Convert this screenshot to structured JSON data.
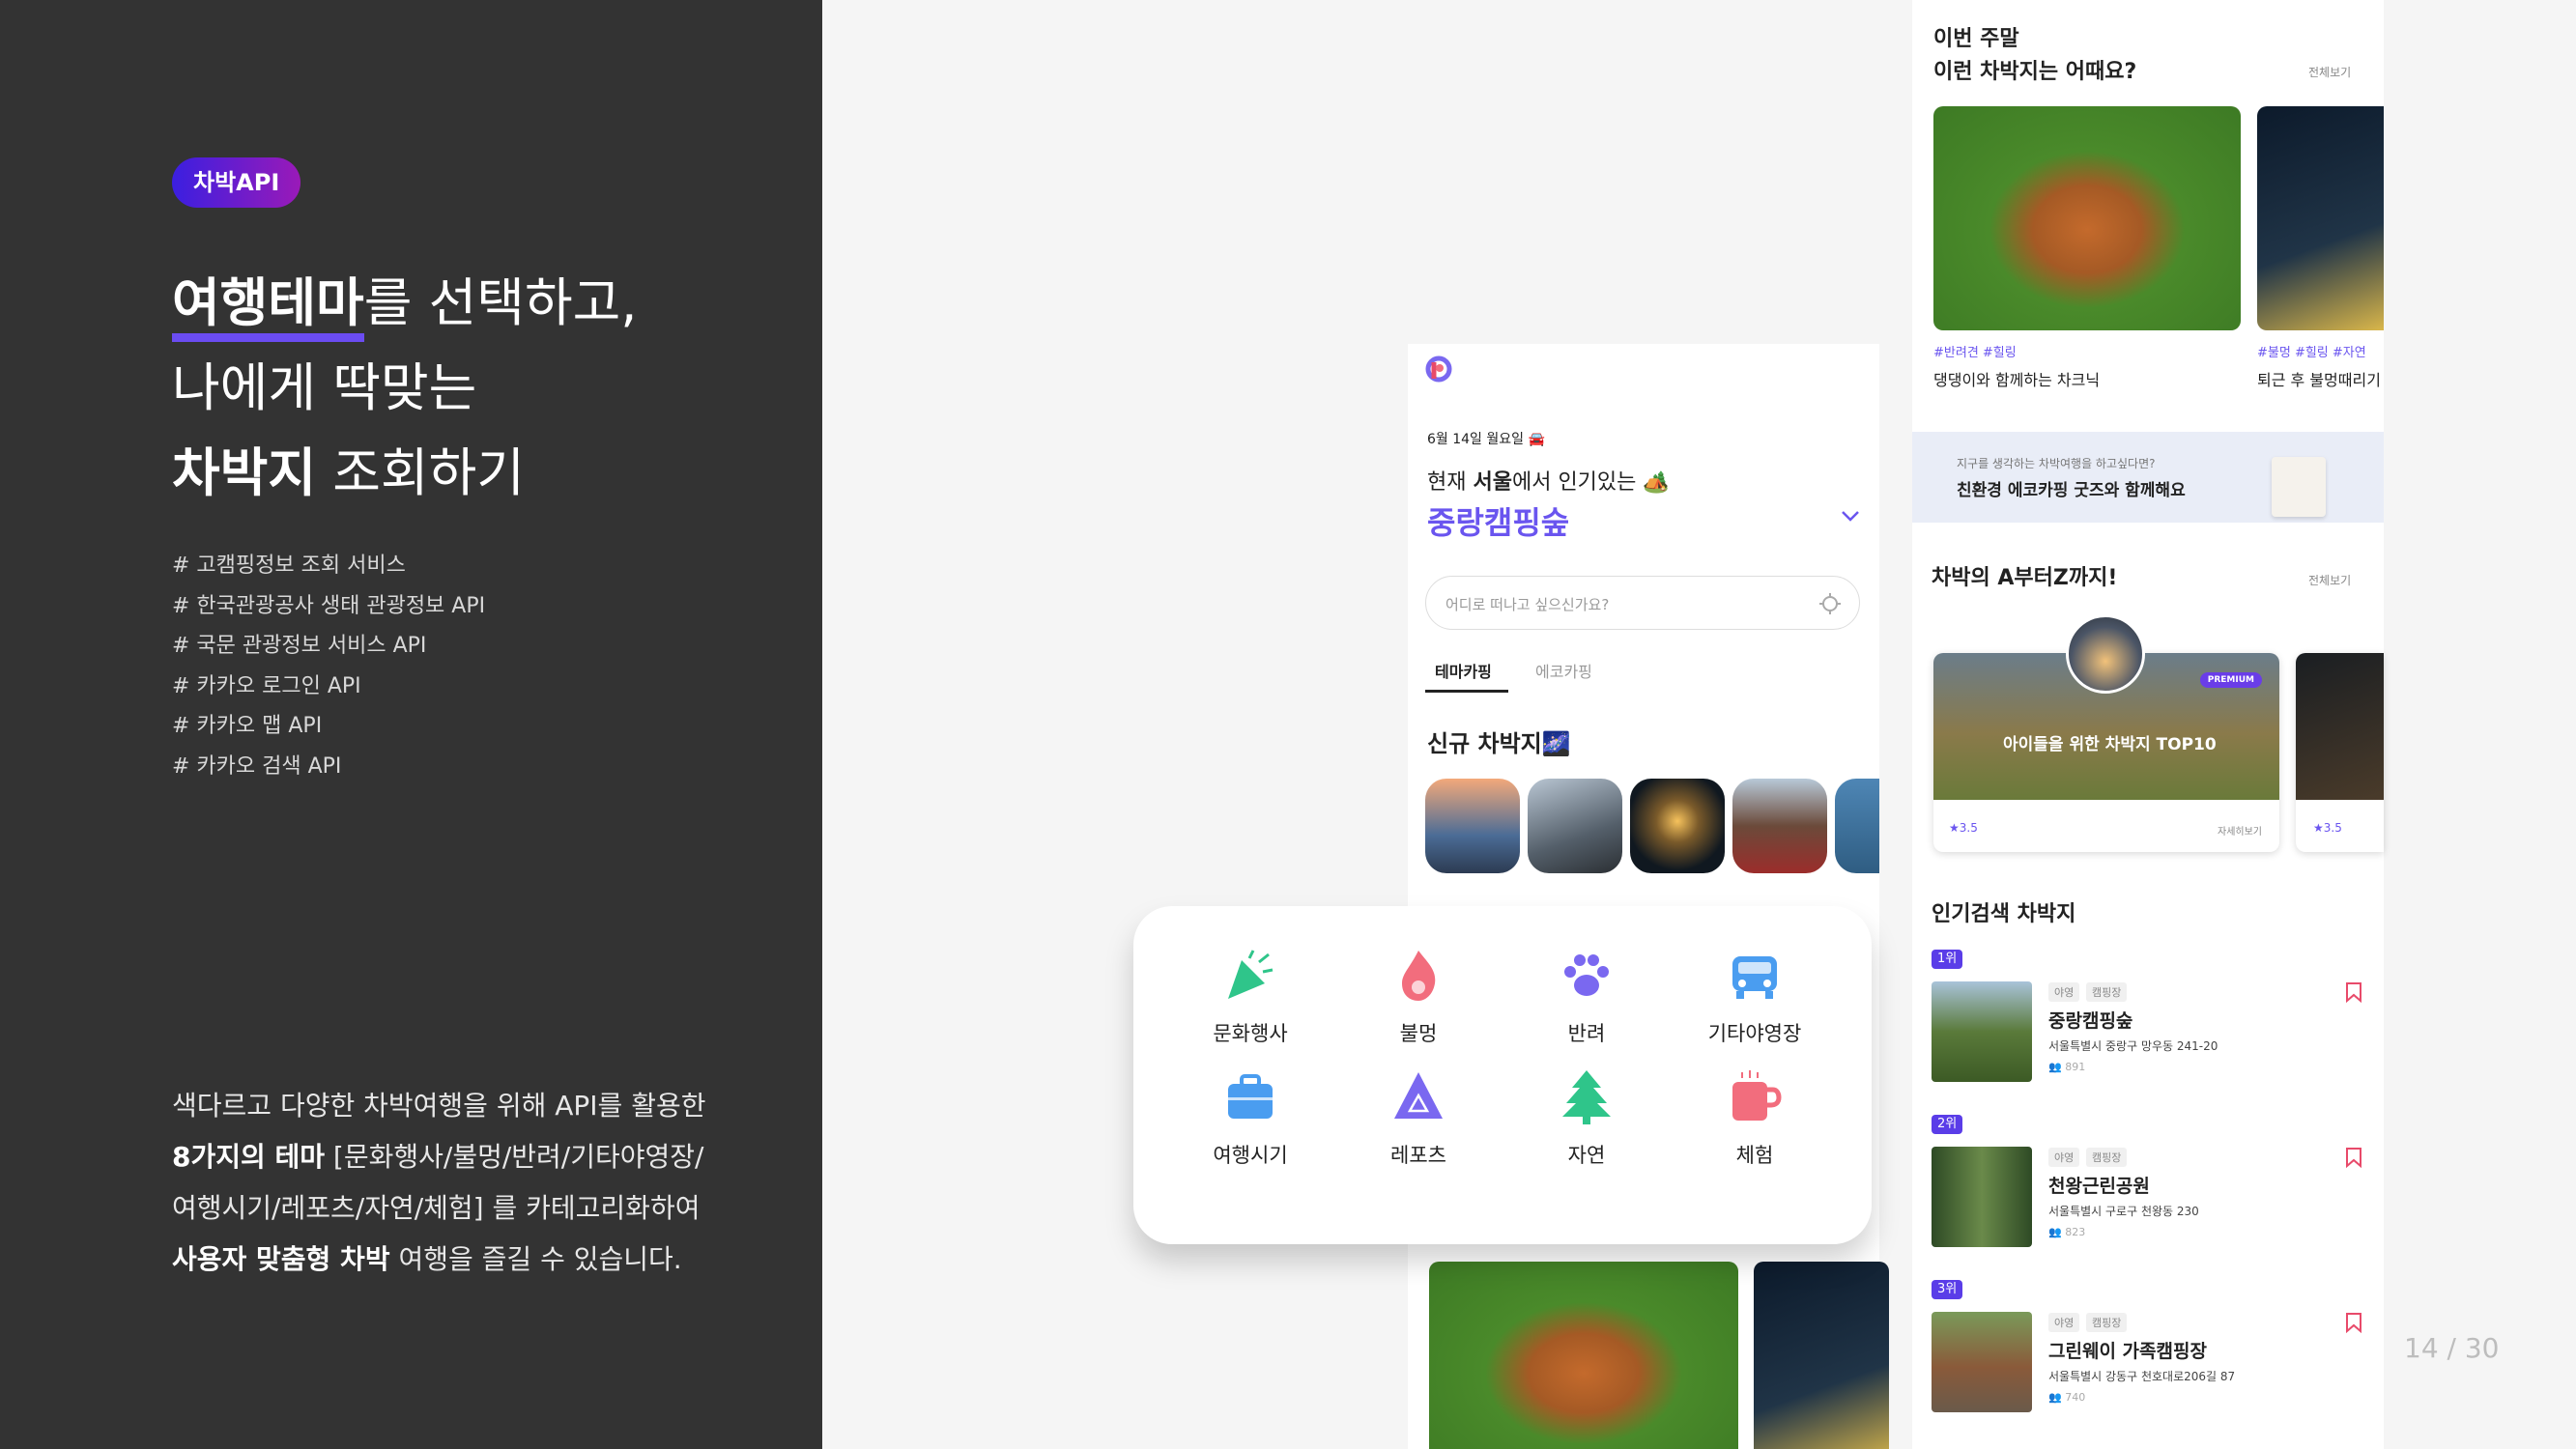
{
  "left_panel": {
    "badge": "차박API",
    "headline": {
      "line1_highlight": "여행테마",
      "line1_rest": "를 선택하고,",
      "line2": "나에게 딱맞는",
      "line3_bold": "차박지",
      "line3_rest": " 조회하기"
    },
    "tags": [
      "# 고캠핑정보 조회 서비스",
      "# 한국관광공사 생태 관광정보 API",
      "# 국문 관광정보 서비스 API",
      "# 카카오 로그인 API",
      "# 카카오 맵 API",
      "# 카카오 검색 API"
    ],
    "description": {
      "l1": "색다르고 다양한 차박여행을 위해 API를 활용한",
      "l2_bold": "8가지의 테마",
      "l2_rest": " [문화행사/불멍/반려/기타야영장/",
      "l3": "여행시기/레포츠/자연/체험] 를 카테고리화하여",
      "l4_bold": "사용자 맞춤형 차박",
      "l4_rest": " 여행을  즐길 수 있습니다."
    }
  },
  "phone_main": {
    "date": "6월 14일 월요일 🚘",
    "popular_prefix": "현재 ",
    "popular_city": "서울",
    "popular_suffix": "에서 인기있는 🏕️",
    "popular_place": "중랑캠핑숲",
    "search_placeholder": "어디로 떠나고 싶으신가요?",
    "tabs": [
      "테마카핑",
      "에코카핑"
    ],
    "new_section_title": "신규 차박지🌌"
  },
  "categories": [
    {
      "label": "문화행사",
      "icon": "party-popper-icon",
      "color": "#2fc58a"
    },
    {
      "label": "불멍",
      "icon": "flame-icon",
      "color": "#f26d7d"
    },
    {
      "label": "반려",
      "icon": "paw-icon",
      "color": "#7a68f0"
    },
    {
      "label": "기타야영장",
      "icon": "car-icon",
      "color": "#4a9df0"
    },
    {
      "label": "여행시기",
      "icon": "briefcase-icon",
      "color": "#4a9df0"
    },
    {
      "label": "레포츠",
      "icon": "triangle-icon",
      "color": "#7a68f0"
    },
    {
      "label": "자연",
      "icon": "tree-icon",
      "color": "#2fc58a"
    },
    {
      "label": "체험",
      "icon": "mug-icon",
      "color": "#f26d7d"
    }
  ],
  "phone_side": {
    "weekend_title_l1": "이번 주말",
    "weekend_title_l2": "이런 차박지는 어때요?",
    "see_all": "전체보기",
    "weekend_cards": [
      {
        "tags": "#반려견 #힐링",
        "title": "댕댕이와 함께하는 차크닉"
      },
      {
        "tags": "#불멍 #힐링 #자연",
        "title": "퇴근 후 불멍때리기"
      }
    ],
    "banner_sub": "지구를 생각하는 차박여행을 하고싶다면?",
    "banner_main": "친환경 에코카핑 굿즈와 함께해요",
    "az_title": "차박의 A부터Z까지!",
    "az_card_title": "아이들을 위한 차박지 TOP10",
    "az_badge": "PREMIUM",
    "az_rating": "★3.5",
    "az_more": "자세히보기",
    "az_rating2": "★3.5",
    "popular_title": "인기검색 차박지",
    "popular_list": [
      {
        "rank": "1위",
        "chips": [
          "야영",
          "캠핑장"
        ],
        "name": "중랑캠핑숲",
        "addr": "서울특별시 중랑구 망우동 241-20",
        "count": "891"
      },
      {
        "rank": "2위",
        "chips": [
          "야영",
          "캠핑장"
        ],
        "name": "천왕근린공원",
        "addr": "서울특별시 구로구 천왕동 230",
        "count": "823"
      },
      {
        "rank": "3위",
        "chips": [
          "야영",
          "캠핑장"
        ],
        "name": "그린웨이 가족캠핑장",
        "addr": "서울특별시 강동구 천호대로206길 87",
        "count": "740"
      }
    ]
  },
  "page_number": "14 / 30"
}
